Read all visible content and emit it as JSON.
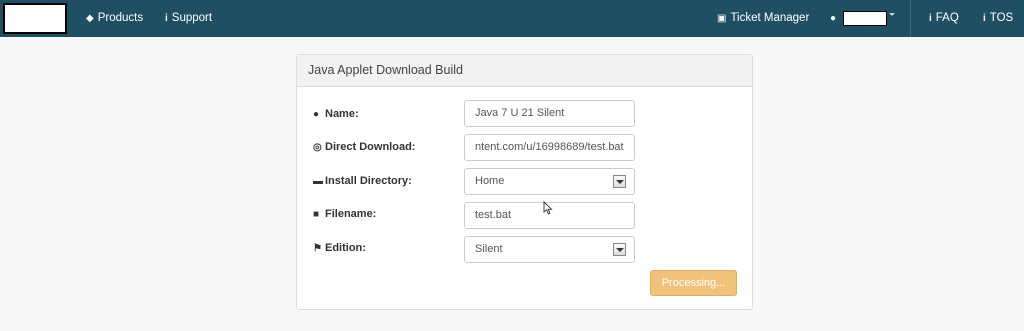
{
  "nav": {
    "products": "Products",
    "support": "Support",
    "ticket_manager": "Ticket Manager",
    "faq": "FAQ",
    "tos": "TOS"
  },
  "panel": {
    "title": "Java Applet Download Build"
  },
  "form": {
    "name_label": "Name:",
    "name_value": "Java 7 U 21 Silent",
    "direct_download_label": "Direct Download:",
    "direct_download_value": "ntent.com/u/16998689/test.bat",
    "install_directory_label": "Install Directory:",
    "install_directory_value": "Home",
    "filename_label": "Filename:",
    "filename_value": "test.bat",
    "edition_label": "Edition:",
    "edition_value": "Silent",
    "processing_label": "Processing..."
  },
  "icons": {
    "products": "tag-icon",
    "support": "info-icon",
    "ticket_manager": "truck-icon",
    "user": "user-icon",
    "faq": "info-icon",
    "name": "user-icon",
    "direct_download": "globe-icon",
    "install_directory": "folder-open-icon",
    "filename": "file-icon",
    "edition": "flag-icon"
  },
  "colors": {
    "navbar": "#1f4f63",
    "processing_button": "#f0c27a"
  }
}
